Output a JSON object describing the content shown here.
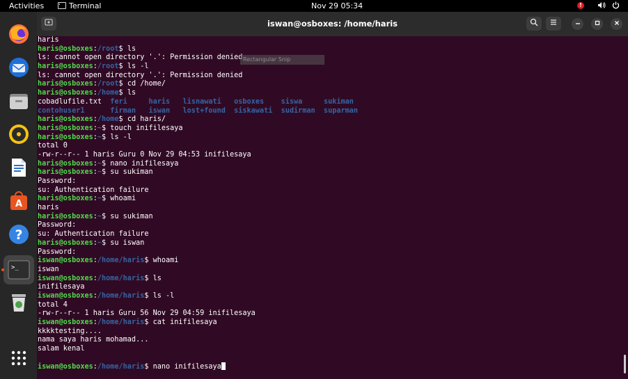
{
  "topbar": {
    "activities": "Activities",
    "app_name": "Terminal",
    "clock": "Nov 29  05:34",
    "notification_badge": "!"
  },
  "window": {
    "title": "iswan@osboxes: /home/haris"
  },
  "overlay": {
    "label": "Rectangular Snip"
  },
  "dock": {
    "apps": [
      "firefox",
      "thunderbird",
      "files",
      "rhythmbox",
      "libreoffice-writer",
      "ubuntu-software",
      "help",
      "terminal",
      "trash",
      "show-applications"
    ]
  },
  "terminal": {
    "lines": [
      [
        {
          "t": "haris"
        }
      ],
      [
        {
          "t": "haris@osboxes",
          "c": "user"
        },
        {
          "t": ":"
        },
        {
          "t": "/root",
          "c": "path"
        },
        {
          "t": "$ ls"
        }
      ],
      [
        {
          "t": "ls: cannot open directory '.': Permission denied"
        }
      ],
      [
        {
          "t": "haris@osboxes",
          "c": "user"
        },
        {
          "t": ":"
        },
        {
          "t": "/root",
          "c": "path"
        },
        {
          "t": "$ ls -l"
        }
      ],
      [
        {
          "t": "ls: cannot open directory '.': Permission denied"
        }
      ],
      [
        {
          "t": "haris@osboxes",
          "c": "user"
        },
        {
          "t": ":"
        },
        {
          "t": "/root",
          "c": "path"
        },
        {
          "t": "$ cd /home/"
        }
      ],
      [
        {
          "t": "haris@osboxes",
          "c": "user"
        },
        {
          "t": ":"
        },
        {
          "t": "/home",
          "c": "path"
        },
        {
          "t": "$ ls"
        }
      ],
      [
        {
          "t": "cobadlufile.txt  "
        },
        {
          "t": "feri     haris   lisnawati   osboxes    siswa     sukiman",
          "c": "dir"
        }
      ],
      [
        {
          "t": "contohuser1      firman   iswan   lost+found  siskawati  sudirman  suparman",
          "c": "dir"
        }
      ],
      [
        {
          "t": "haris@osboxes",
          "c": "user"
        },
        {
          "t": ":"
        },
        {
          "t": "/home",
          "c": "path"
        },
        {
          "t": "$ cd haris/"
        }
      ],
      [
        {
          "t": "haris@osboxes",
          "c": "user"
        },
        {
          "t": ":"
        },
        {
          "t": "~",
          "c": "path"
        },
        {
          "t": "$ touch inifilesaya"
        }
      ],
      [
        {
          "t": "haris@osboxes",
          "c": "user"
        },
        {
          "t": ":"
        },
        {
          "t": "~",
          "c": "path"
        },
        {
          "t": "$ ls -l"
        }
      ],
      [
        {
          "t": "total 0"
        }
      ],
      [
        {
          "t": "-rw-r--r-- 1 haris Guru 0 Nov 29 04:53 inifilesaya"
        }
      ],
      [
        {
          "t": "haris@osboxes",
          "c": "user"
        },
        {
          "t": ":"
        },
        {
          "t": "~",
          "c": "path"
        },
        {
          "t": "$ nano inifilesaya"
        }
      ],
      [
        {
          "t": "haris@osboxes",
          "c": "user"
        },
        {
          "t": ":"
        },
        {
          "t": "~",
          "c": "path"
        },
        {
          "t": "$ su sukiman"
        }
      ],
      [
        {
          "t": "Password:"
        }
      ],
      [
        {
          "t": "su: Authentication failure"
        }
      ],
      [
        {
          "t": "haris@osboxes",
          "c": "user"
        },
        {
          "t": ":"
        },
        {
          "t": "~",
          "c": "path"
        },
        {
          "t": "$ whoami"
        }
      ],
      [
        {
          "t": "haris"
        }
      ],
      [
        {
          "t": "haris@osboxes",
          "c": "user"
        },
        {
          "t": ":"
        },
        {
          "t": "~",
          "c": "path"
        },
        {
          "t": "$ su sukiman"
        }
      ],
      [
        {
          "t": "Password:"
        }
      ],
      [
        {
          "t": "su: Authentication failure"
        }
      ],
      [
        {
          "t": "haris@osboxes",
          "c": "user"
        },
        {
          "t": ":"
        },
        {
          "t": "~",
          "c": "path"
        },
        {
          "t": "$ su iswan"
        }
      ],
      [
        {
          "t": "Password:"
        }
      ],
      [
        {
          "t": "iswan@osboxes",
          "c": "user"
        },
        {
          "t": ":"
        },
        {
          "t": "/home/haris",
          "c": "path"
        },
        {
          "t": "$ whoami"
        }
      ],
      [
        {
          "t": "iswan"
        }
      ],
      [
        {
          "t": "iswan@osboxes",
          "c": "user"
        },
        {
          "t": ":"
        },
        {
          "t": "/home/haris",
          "c": "path"
        },
        {
          "t": "$ ls"
        }
      ],
      [
        {
          "t": "inifilesaya"
        }
      ],
      [
        {
          "t": "iswan@osboxes",
          "c": "user"
        },
        {
          "t": ":"
        },
        {
          "t": "/home/haris",
          "c": "path"
        },
        {
          "t": "$ ls -l"
        }
      ],
      [
        {
          "t": "total 4"
        }
      ],
      [
        {
          "t": "-rw-r--r-- 1 haris Guru 56 Nov 29 04:59 inifilesaya"
        }
      ],
      [
        {
          "t": "iswan@osboxes",
          "c": "user"
        },
        {
          "t": ":"
        },
        {
          "t": "/home/haris",
          "c": "path"
        },
        {
          "t": "$ cat inifilesaya"
        }
      ],
      [
        {
          "t": "kkkktesting...."
        }
      ],
      [
        {
          "t": "nama saya haris mohamad..."
        }
      ],
      [
        {
          "t": "salam kenal"
        }
      ],
      [
        {
          "t": ""
        }
      ],
      [
        {
          "t": "iswan@osboxes",
          "c": "user"
        },
        {
          "t": ":"
        },
        {
          "t": "/home/haris",
          "c": "path"
        },
        {
          "t": "$ nano inifilesaya"
        },
        {
          "cursor": true
        }
      ]
    ]
  }
}
